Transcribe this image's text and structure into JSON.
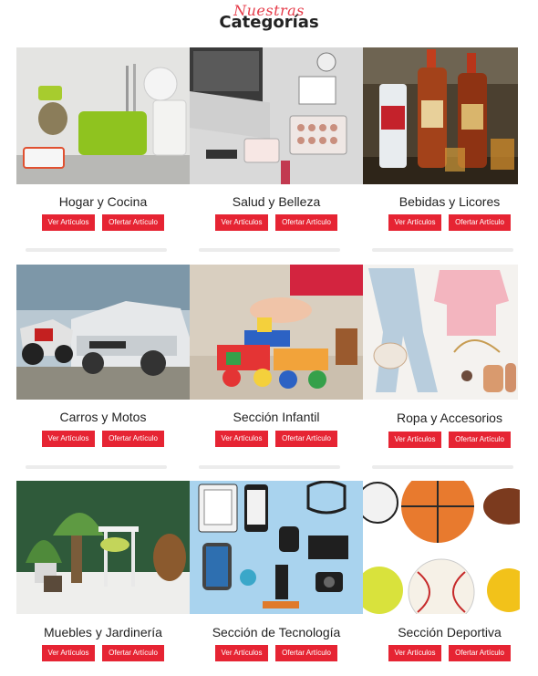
{
  "header": {
    "script_text": "Nuestras",
    "title": "Categorías"
  },
  "buttons": {
    "view": "Ver Artículos",
    "offer": "Ofertar Artículo"
  },
  "categories": [
    {
      "name": "Hogar y Cocina"
    },
    {
      "name": "Salud y Belleza"
    },
    {
      "name": "Bebidas y Licores"
    },
    {
      "name": "Carros y Motos"
    },
    {
      "name": "Sección Infantil"
    },
    {
      "name": "Ropa y Accesorios"
    },
    {
      "name": "Muebles y Jardinería"
    },
    {
      "name": "Sección de Tecnología"
    },
    {
      "name": "Sección Deportiva"
    }
  ]
}
